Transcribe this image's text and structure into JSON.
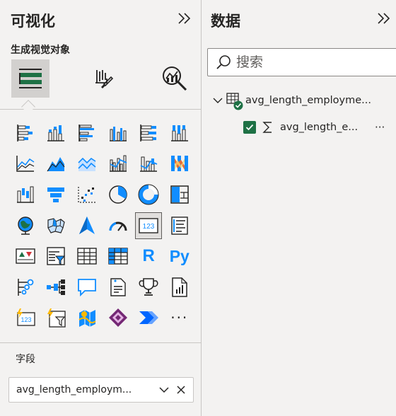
{
  "viz_pane": {
    "title": "可视化",
    "subheading": "生成视觉对象",
    "fields_label": "字段",
    "field_well_value": "avg_length_employm..."
  },
  "data_pane": {
    "title": "数据",
    "search_placeholder": "搜索",
    "table_name": "avg_length_employme...",
    "field_name": "avg_length_e...",
    "more_label": "···"
  },
  "visuals": [
    "stacked-bar-chart",
    "stacked-column-chart",
    "clustered-bar-chart",
    "clustered-column-chart",
    "100-stacked-bar-chart",
    "100-stacked-column-chart",
    "line-chart",
    "area-chart",
    "stacked-area-chart",
    "line-clustered-column-chart",
    "line-stacked-column-chart",
    "ribbon-chart",
    "waterfall-chart",
    "funnel-chart",
    "scatter-chart",
    "pie-chart",
    "donut-chart",
    "treemap",
    "map",
    "filled-map",
    "azure-map",
    "gauge",
    "card",
    "multi-row-card",
    "kpi",
    "slicer",
    "table",
    "matrix",
    "r-visual",
    "python-visual",
    "key-influencers",
    "decomposition-tree",
    "qa",
    "smart-narrative",
    "metrics",
    "paginated-report",
    "power-apps",
    "power-automate",
    "azure-maps-2",
    "power-apps-2",
    "power-automate-2",
    "more-visuals"
  ],
  "visual_text": {
    "r": "R",
    "py": "Py",
    "card_num": "123",
    "more": "···"
  },
  "colors": {
    "accent": "#118dff",
    "pane_bg": "#f3f2f1",
    "check_green": "#1e7145",
    "icon_dark": "#252423"
  }
}
